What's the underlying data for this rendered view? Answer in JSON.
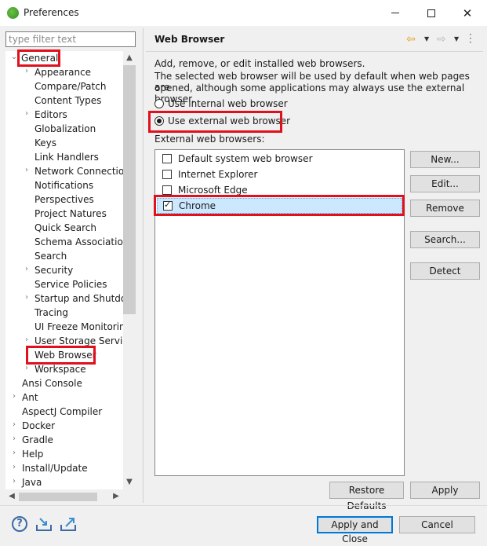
{
  "window": {
    "title": "Preferences",
    "minimize": "–",
    "maximize": "□",
    "close": "✕"
  },
  "filter": {
    "placeholder": "type filter text"
  },
  "tree": {
    "general": "General",
    "children": [
      "Appearance",
      "Compare/Patch",
      "Content Types",
      "Editors",
      "Globalization",
      "Keys",
      "Link Handlers",
      "Network Connections",
      "Notifications",
      "Perspectives",
      "Project Natures",
      "Quick Search",
      "Schema Associations",
      "Search",
      "Security",
      "Service Policies",
      "Startup and Shutdown",
      "Tracing",
      "UI Freeze Monitoring",
      "User Storage Service",
      "Web Browser",
      "Workspace"
    ],
    "top_level": [
      "Ansi Console",
      "Ant",
      "AspectJ Compiler",
      "Docker",
      "Gradle",
      "Help",
      "Install/Update",
      "Java"
    ]
  },
  "page": {
    "title": "Web Browser",
    "description_1": "Add, remove, or edit installed web browsers.",
    "description_2": "The selected web browser will be used by default when web pages are",
    "description_3": "opened, although some applications may always use the external browser.",
    "radio_internal": "Use internal web browser",
    "radio_external": "Use external web browser",
    "list_label": "External web browsers:",
    "browsers": [
      {
        "name": "Default system web browser",
        "checked": false
      },
      {
        "name": "Internet Explorer",
        "checked": false
      },
      {
        "name": "Microsoft Edge",
        "checked": false
      },
      {
        "name": "Chrome",
        "checked": true
      }
    ],
    "buttons": {
      "new": "New...",
      "edit": "Edit...",
      "remove": "Remove",
      "search": "Search...",
      "detect": "Detect"
    },
    "restore_defaults": "Restore Defaults",
    "apply": "Apply"
  },
  "footer": {
    "apply_and_close": "Apply and Close",
    "cancel": "Cancel",
    "help": "?"
  },
  "colors": {
    "highlight": "#e0101d",
    "selection": "#cce8ff",
    "default_button_border": "#0078d7"
  }
}
